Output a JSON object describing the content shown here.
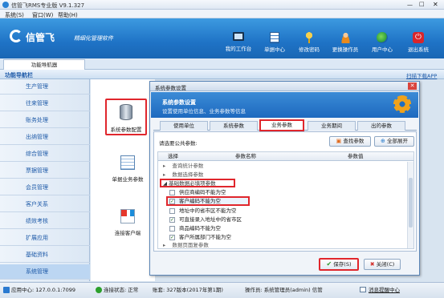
{
  "app": {
    "title": "信管飞RMS专业版 V9.1.327",
    "logo_text": "信管飞",
    "slogan": "精细化管理软件"
  },
  "menu": [
    "系统(S)",
    "窗口(W)",
    "帮助(H)"
  ],
  "toolbar": [
    {
      "label": "我的工作台",
      "icon": "monitor-icon"
    },
    {
      "label": "单据中心",
      "icon": "document-icon"
    },
    {
      "label": "修改密码",
      "icon": "key-icon"
    },
    {
      "label": "更换操作员",
      "icon": "user-icon"
    },
    {
      "label": "用户中心",
      "icon": "globe-icon"
    },
    {
      "label": "退出系统",
      "icon": "power-icon"
    }
  ],
  "tab": {
    "label": "功能导航器"
  },
  "navbar": {
    "title": "功能导航栏",
    "link": "扫描下载APP"
  },
  "sidebar": [
    "生产管理",
    "往来管理",
    "账务处理",
    "出纳管理",
    "综合管理",
    "票据管理",
    "会员管理",
    "客户关系",
    "绩效考核",
    "扩展应用",
    "基础资料",
    "系统管理"
  ],
  "mid_icons": [
    {
      "label": "系统参数配置",
      "icon": "database-gear-icon"
    },
    {
      "label": "单据业务参数",
      "icon": "form-gear-icon"
    },
    {
      "label": "连接客户端",
      "icon": "network-icon"
    }
  ],
  "dialog": {
    "title": "系统参数设置",
    "header_title": "系统参数设置",
    "header_sub": "设置使用单位信息、业务参数等信息",
    "tabs": [
      "使用单位",
      "系统参数",
      "业务参数",
      "业务期間",
      "出的参数"
    ],
    "tabs_fixed": [
      "使用单位",
      "系统参数",
      "业务参数",
      "业务期间",
      "出的参数"
    ],
    "select_label": "请选要公共参数:",
    "find_btn": "查找参数",
    "expand_btn": "全部展开",
    "col_select": "选择",
    "col_name": "参数名称",
    "col_value": "参数值",
    "rows": [
      {
        "label": "查询统计参数",
        "level": 0,
        "expand": "+"
      },
      {
        "label": "数据选择参数",
        "level": 0,
        "expand": "+"
      },
      {
        "label": "基础数据必填项参数",
        "level": 0,
        "expand": "-"
      },
      {
        "label": "供应商编码不能为空",
        "level": 1,
        "checked": false
      },
      {
        "label": "客户编码不能为空",
        "level": 1,
        "checked": true
      },
      {
        "label": "地址中的省市区不能为空",
        "level": 1,
        "checked": false
      },
      {
        "label": "可直接录入地址中的省市区",
        "level": 1,
        "checked": true
      },
      {
        "label": "商品编码不能为空",
        "level": 1,
        "checked": false
      },
      {
        "label": "客户所属部门不能为空",
        "level": 1,
        "checked": true
      },
      {
        "label": "数据页面复参数",
        "level": 0,
        "expand": "+"
      }
    ],
    "save_btn": "保存(S)",
    "close_btn": "关闭(C)"
  },
  "status": {
    "app_center": "应用中心: 127.0.0.1:7099",
    "connect": "连接状态: 正常",
    "account": "账套: 327版本(2017年第1期)",
    "operator": "操作员: 系统管理员(admin) 信管",
    "message": "消息提醒中心"
  }
}
